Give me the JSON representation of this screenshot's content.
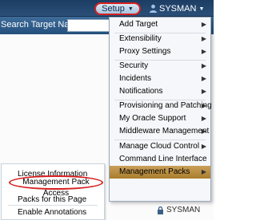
{
  "header": {
    "setup_label": "Setup",
    "user_label": "SYSMAN",
    "search_label": "Search Target Name"
  },
  "setup_menu": {
    "items": [
      {
        "label": "Add Target",
        "has_submenu": true
      },
      {
        "label": "Extensibility",
        "has_submenu": true
      },
      {
        "label": "Proxy Settings",
        "has_submenu": true
      },
      {
        "label": "Security",
        "has_submenu": true
      },
      {
        "label": "Incidents",
        "has_submenu": true
      },
      {
        "label": "Notifications",
        "has_submenu": true
      },
      {
        "label": "Provisioning and Patching",
        "has_submenu": true
      },
      {
        "label": "My Oracle Support",
        "has_submenu": true
      },
      {
        "label": "Middleware Management",
        "has_submenu": true
      },
      {
        "label": "Manage Cloud Control",
        "has_submenu": true
      },
      {
        "label": "Command Line Interface",
        "has_submenu": false
      },
      {
        "label": "Management Packs",
        "has_submenu": true,
        "active": true
      }
    ]
  },
  "submenu": {
    "items": [
      {
        "label": "License Information"
      },
      {
        "label": "Management Pack Access",
        "highlighted": true
      },
      {
        "label": "Packs for this Page"
      },
      {
        "label": "Enable Annotations"
      }
    ]
  },
  "footer": {
    "user_label": "SYSMAN"
  },
  "colors": {
    "header_dark": "#1c3d63",
    "highlight_ring": "#d62020",
    "active_item": "#b8893e"
  }
}
